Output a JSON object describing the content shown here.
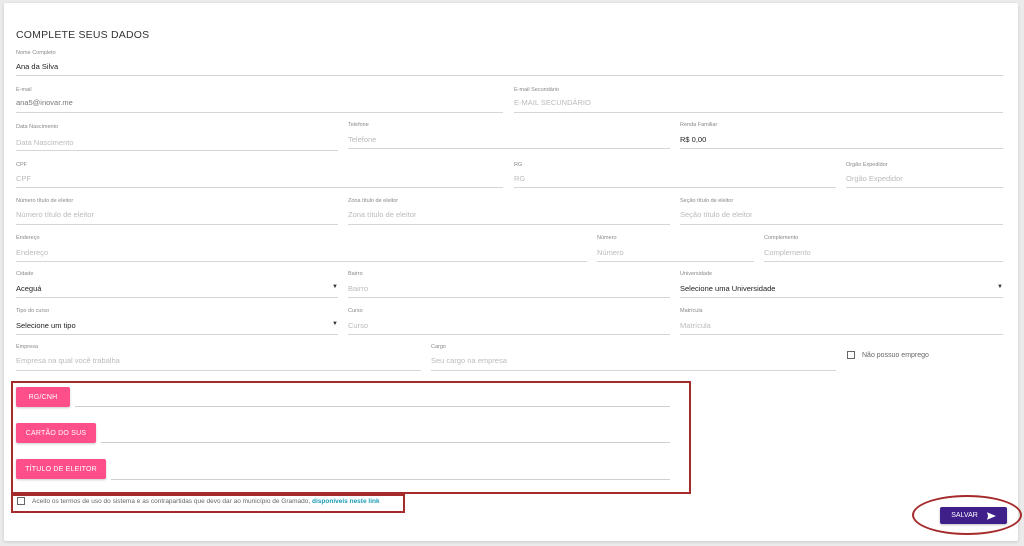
{
  "form": {
    "title": "COMPLETE SEUS DADOS",
    "fields": {
      "nome": {
        "label": "Nome Completo",
        "value": "Ana da Silva"
      },
      "email": {
        "label": "E-mail",
        "value": "ana5@inovar.me"
      },
      "email2": {
        "label": "E-mail Secundário",
        "placeholder": "E-MAIL SECUNDÁRIO"
      },
      "nascimento": {
        "label": "Data Nascimento",
        "placeholder": "Data Nascimento"
      },
      "telefone": {
        "label": "Telefone",
        "placeholder": "Telefone"
      },
      "renda": {
        "label": "Renda Familiar",
        "value": "R$ 0,00"
      },
      "cpf": {
        "label": "CPF",
        "placeholder": "CPF"
      },
      "rg": {
        "label": "RG",
        "placeholder": "RG"
      },
      "orgao": {
        "label": "Orgão Expedidor",
        "placeholder": "Orgão Expedidor"
      },
      "titulo_num": {
        "label": "Número título de eleitor",
        "placeholder": "Número título de eleitor"
      },
      "titulo_zona": {
        "label": "Zona título de eleitor",
        "placeholder": "Zona título de eleitor"
      },
      "titulo_secao": {
        "label": "Seção título de eleitor",
        "placeholder": "Seção título de eleitor"
      },
      "endereco": {
        "label": "Endereço",
        "placeholder": "Endereço"
      },
      "numero": {
        "label": "Número",
        "placeholder": "Número"
      },
      "complemento": {
        "label": "Complemento",
        "placeholder": "Complemento"
      },
      "cidade": {
        "label": "Cidade",
        "value": "Aceguá"
      },
      "bairro": {
        "label": "Bairro",
        "placeholder": "Bairro"
      },
      "universidade": {
        "label": "Universidade",
        "value": "Selecione uma Universidade"
      },
      "tipo_curso": {
        "label": "Tipo do curso",
        "value": "Selecione um tipo"
      },
      "curso": {
        "label": "Curso",
        "placeholder": "Curso"
      },
      "matricula": {
        "label": "Matrícula",
        "placeholder": "Matrícula"
      },
      "empresa": {
        "label": "Empresa",
        "placeholder": "Empresa na qual você trabalha"
      },
      "cargo": {
        "label": "Cargo",
        "placeholder": "Seu cargo na empresa"
      }
    },
    "no_job_label": "Não possuo emprego",
    "uploads": [
      "RG/CNH",
      "CARTÃO DO SUS",
      "TÍTULO DE ELEITOR"
    ],
    "terms": {
      "text": "Aceito os termos de uso do sistema e as contrapartidas que devo dar ao município de Gramado,",
      "link": "disponíveis neste link"
    },
    "save_label": "SALVAR",
    "icons": {
      "send": "send-icon",
      "dropdown": "dropdown-caret-icon",
      "checkbox": "checkbox-icon"
    },
    "colors": {
      "pink": "#ff4f8b",
      "purple": "#3f1f8a",
      "link": "#1a9bb5",
      "highlight": "#a52a2a"
    }
  }
}
